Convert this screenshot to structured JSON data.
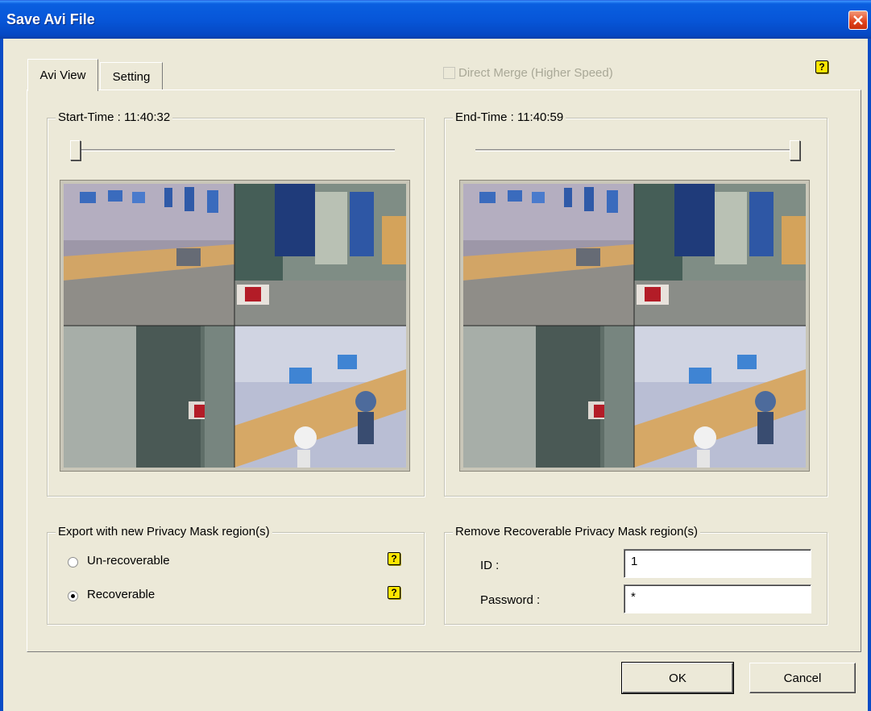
{
  "window": {
    "title": "Save Avi File"
  },
  "tabs": [
    {
      "label": "Avi View",
      "active": true
    },
    {
      "label": "Setting",
      "active": false
    }
  ],
  "direct_merge": {
    "label": "Direct Merge (Higher Speed)",
    "checked": false,
    "enabled": false
  },
  "start_panel": {
    "label": "Start-Time : 11:40:32",
    "slider_position": 0
  },
  "end_panel": {
    "label": "End-Time : 11:40:59",
    "slider_position": 1
  },
  "privacy_export": {
    "label": "Export with new Privacy Mask region(s)",
    "options": [
      {
        "label": "Un-recoverable",
        "selected": false
      },
      {
        "label": "Recoverable",
        "selected": true
      }
    ]
  },
  "remove_recoverable": {
    "label": "Remove Recoverable Privacy Mask region(s)",
    "id_label": "ID :",
    "id_value": "1",
    "password_label": "Password :",
    "password_value": "*"
  },
  "buttons": {
    "ok": "OK",
    "cancel": "Cancel"
  },
  "icons": {
    "help": "help-icon",
    "close": "close-icon"
  },
  "colors": {
    "titlebar": "#0756d8",
    "dialog_bg": "#ece9d8",
    "help_icon": "#ffe600"
  }
}
